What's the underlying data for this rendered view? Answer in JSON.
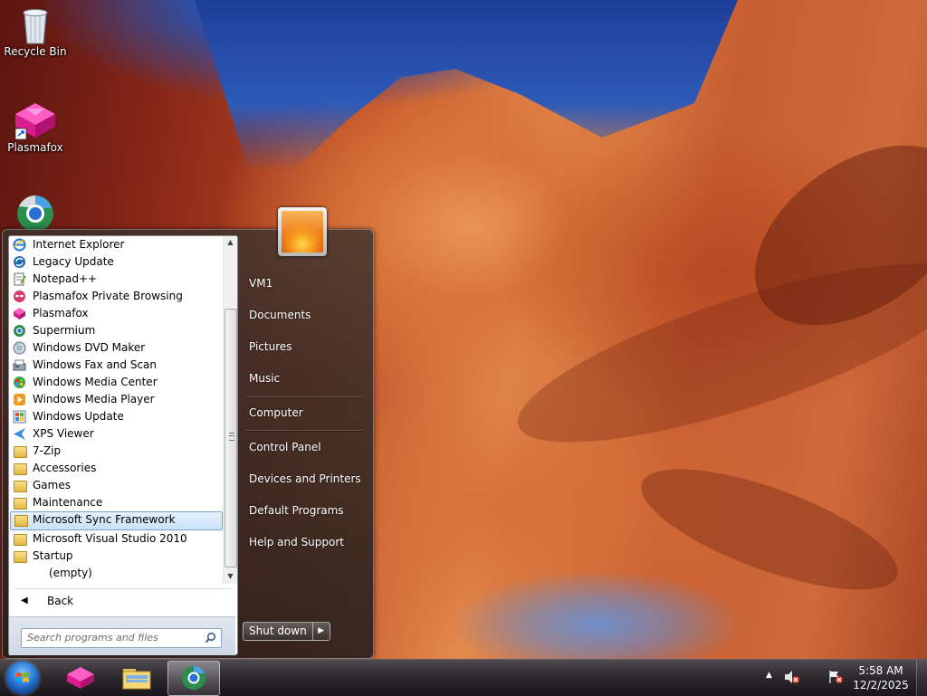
{
  "desktop": {
    "icons": [
      {
        "label": "Recycle Bin",
        "icon": "recycle-bin-icon"
      },
      {
        "label": "Plasmafox",
        "icon": "plasmafox-icon"
      },
      {
        "label": "",
        "icon": "supermium-icon"
      }
    ]
  },
  "start_menu": {
    "programs": [
      {
        "label": "Internet Explorer",
        "icon": "internet-explorer-icon"
      },
      {
        "label": "Legacy Update",
        "icon": "legacy-update-icon"
      },
      {
        "label": "Notepad++",
        "icon": "notepad-plus-plus-icon"
      },
      {
        "label": "Plasmafox Private Browsing",
        "icon": "plasmafox-private-icon"
      },
      {
        "label": "Plasmafox",
        "icon": "plasmafox-icon"
      },
      {
        "label": "Supermium",
        "icon": "supermium-icon"
      },
      {
        "label": "Windows DVD Maker",
        "icon": "dvd-maker-icon"
      },
      {
        "label": "Windows Fax and Scan",
        "icon": "fax-scan-icon"
      },
      {
        "label": "Windows Media Center",
        "icon": "media-center-icon"
      },
      {
        "label": "Windows Media Player",
        "icon": "media-player-icon"
      },
      {
        "label": "Windows Update",
        "icon": "windows-update-icon"
      },
      {
        "label": "XPS Viewer",
        "icon": "xps-viewer-icon"
      },
      {
        "label": "7-Zip",
        "icon": "folder-icon"
      },
      {
        "label": "Accessories",
        "icon": "folder-icon"
      },
      {
        "label": "Games",
        "icon": "folder-icon"
      },
      {
        "label": "Maintenance",
        "icon": "folder-icon"
      },
      {
        "label": "Microsoft Sync Framework",
        "icon": "folder-icon",
        "selected": true
      },
      {
        "label": "Microsoft Visual Studio 2010",
        "icon": "folder-icon"
      },
      {
        "label": "Startup",
        "icon": "folder-icon"
      },
      {
        "label": "(empty)",
        "icon": ""
      }
    ],
    "back_label": "Back",
    "search_placeholder": "Search programs and files",
    "right_items": [
      "VM1",
      "Documents",
      "Pictures",
      "Music",
      "Computer",
      "Control Panel",
      "Devices and Printers",
      "Default Programs",
      "Help and Support"
    ],
    "shutdown_label": "Shut down"
  },
  "taskbar": {
    "pinned": [
      {
        "name": "plasmafox",
        "icon": "plasmafox-icon"
      },
      {
        "name": "file-explorer",
        "icon": "folder-icon"
      },
      {
        "name": "supermium",
        "icon": "supermium-icon",
        "active": true
      }
    ],
    "clock": {
      "time": "5:58 AM",
      "date": "12/2/2025"
    }
  }
}
